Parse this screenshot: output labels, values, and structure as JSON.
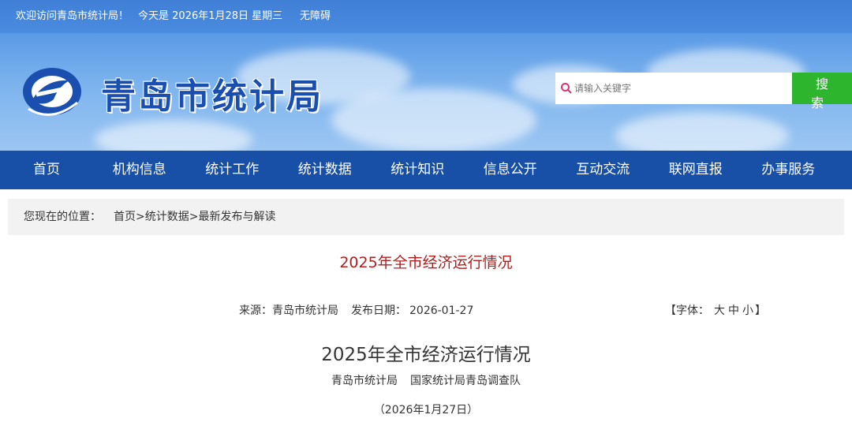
{
  "topbar": {
    "welcome": "欢迎访问青岛市统计局！",
    "today": "今天是 2026年1月28日 星期三",
    "accessibility": "无障碍"
  },
  "header": {
    "site_name": "青岛市统计局",
    "search_placeholder": "请输入关键字",
    "search_button": "搜 索"
  },
  "nav": {
    "items": [
      "首页",
      "机构信息",
      "统计工作",
      "统计数据",
      "统计知识",
      "信息公开",
      "互动交流",
      "联网直报",
      "办事服务"
    ]
  },
  "breadcrumb": {
    "label": "您现在的位置：",
    "items": [
      "首页",
      "统计数据",
      "最新发布与解读"
    ],
    "separator": ">"
  },
  "article": {
    "page_title": "2025年全市经济运行情况",
    "source_label": "来源：",
    "source": "青岛市统计局",
    "date_label": "发布日期：",
    "date": "2026-01-27",
    "font_prefix": "【字体：",
    "font_large": "大",
    "font_medium": "中",
    "font_small": "小",
    "font_suffix": "】",
    "doc_title": "2025年全市经济运行情况",
    "author_1": "青岛市统计局",
    "author_2": "国家统计局青岛调查队",
    "doc_date": "（2026年1月27日）"
  },
  "colors": {
    "nav_bg": "#1850a8",
    "title_red": "#b01e1e",
    "search_green": "#2db52d"
  }
}
